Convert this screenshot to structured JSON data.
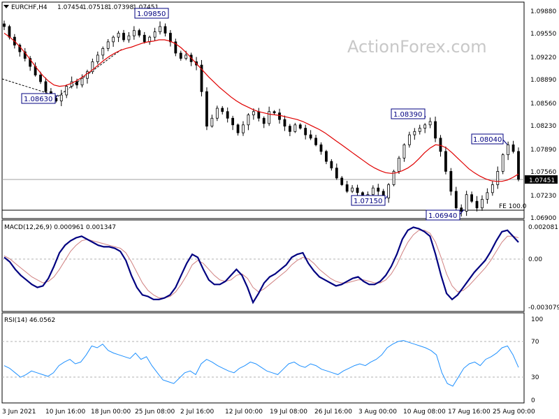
{
  "chart_data": [
    {
      "type": "candlestick",
      "panel": "price",
      "header": {
        "symbol": "EURCHF,H4",
        "ohlc": [
          "1.07454",
          "1.07518",
          "1.07398",
          "1.07451"
        ]
      },
      "watermark": "ActionForex.com",
      "ylim": [
        1.069,
        1.0999
      ],
      "yticks": [
        "1.09880",
        "1.09550",
        "1.09220",
        "1.08890",
        "1.08560",
        "1.08230",
        "1.07890",
        "1.07560",
        "1.07230",
        "1.06900"
      ],
      "current_price_label": "1.07451",
      "fe_label": "FE 100.0",
      "fe_level": 1.0698,
      "annotations": [
        "1.09850",
        "1.08630",
        "1.08390",
        "1.07150",
        "1.06940",
        "1.08040"
      ],
      "close_series": [
        1.0978,
        1.0962,
        1.095,
        1.094,
        1.093,
        1.0918,
        1.0905,
        1.0895,
        1.088,
        1.087,
        1.0866,
        1.0875,
        1.0888,
        1.0895,
        1.089,
        1.09,
        1.091,
        1.0925,
        1.0935,
        1.0945,
        1.0955,
        1.0962,
        1.0968,
        1.0958,
        1.0964,
        1.0972,
        1.0965,
        1.0955,
        1.0962,
        1.097,
        1.0978,
        1.0968,
        1.0955,
        1.0938,
        1.093,
        1.0935,
        1.0925,
        1.092,
        1.088,
        1.0828,
        1.084,
        1.0855,
        1.085,
        1.084,
        1.083,
        1.0818,
        1.083,
        1.0845,
        1.085,
        1.084,
        1.0832,
        1.085,
        1.0848,
        1.0838,
        1.0828,
        1.082,
        1.083,
        1.0825,
        1.0815,
        1.081,
        1.08,
        1.079,
        1.0775,
        1.0765,
        1.075,
        1.074,
        1.073,
        1.0735,
        1.0728,
        1.072,
        1.0725,
        1.0735,
        1.073,
        1.072,
        1.074,
        1.076,
        1.078,
        1.08,
        1.0815,
        1.082,
        1.0825,
        1.083,
        1.0835,
        1.081,
        1.079,
        1.076,
        1.073,
        1.0705,
        1.07,
        1.0725,
        1.0715,
        1.0705,
        1.0718,
        1.0728,
        1.074,
        1.076,
        1.0785,
        1.08,
        1.079,
        1.0748
      ],
      "ma_series": [
        1.0968,
        1.0962,
        1.0955,
        1.0946,
        1.0936,
        1.0925,
        1.0914,
        1.0904,
        1.0896,
        1.089,
        1.0888,
        1.0889,
        1.0892,
        1.0896,
        1.0901,
        1.0907,
        1.0913,
        1.092,
        1.0927,
        1.0933,
        1.0938,
        1.0942,
        1.0945,
        1.0947,
        1.095,
        1.0953,
        1.0955,
        1.0956,
        1.0958,
        1.0958,
        1.0956,
        1.0952,
        1.0946,
        1.0938,
        1.0929,
        1.092,
        1.0911,
        1.0902,
        1.0894,
        1.0886,
        1.0879,
        1.0872,
        1.0866,
        1.0861,
        1.0857,
        1.0853,
        1.085,
        1.0848,
        1.0846,
        1.0845,
        1.0844,
        1.0842,
        1.084,
        1.0838,
        1.0835,
        1.0831,
        1.0827,
        1.0823,
        1.0818,
        1.0812,
        1.0806,
        1.08,
        1.0794,
        1.0788,
        1.0782,
        1.0776,
        1.077,
        1.0765,
        1.0761,
        1.0758,
        1.0757,
        1.0758,
        1.0761,
        1.0765,
        1.0771,
        1.0779,
        1.0788,
        1.0795,
        1.08,
        1.0799,
        1.0795,
        1.0788,
        1.078,
        1.0772,
        1.0764,
        1.0758,
        1.0753,
        1.0749,
        1.0746,
        1.0745,
        1.0745,
        1.0747,
        1.0751,
        1.0756
      ]
    },
    {
      "type": "line",
      "panel": "macd",
      "header": "MACD(12,26,9) 0.000961 0.001347",
      "yticks": [
        "0.002081",
        "0.00",
        "-0.003079"
      ],
      "ylim": [
        -0.00332,
        0.00225
      ],
      "series": [
        {
          "values": [
            0.0,
            -0.0003,
            -0.0008,
            -0.0012,
            -0.0015,
            -0.0018,
            -0.002,
            -0.0019,
            -0.0014,
            -0.0006,
            0.0003,
            0.0008,
            0.0011,
            0.0013,
            0.0014,
            0.0012,
            0.001,
            0.0008,
            0.0007,
            0.0007,
            0.0006,
            0.0004,
            -0.0002,
            -0.0012,
            -0.002,
            -0.0025,
            -0.0026,
            -0.0028,
            -0.0028,
            -0.0027,
            -0.0025,
            -0.002,
            -0.0012,
            -0.0004,
            0.0002,
            0.0,
            -0.0008,
            -0.0015,
            -0.0018,
            -0.0018,
            -0.0016,
            -0.0012,
            -0.0008,
            -0.0012,
            -0.002,
            -0.003,
            -0.0024,
            -0.0017,
            -0.0013,
            -0.0011,
            -0.0008,
            -0.0005,
            0.0,
            0.0002,
            0.0003,
            -0.0004,
            -0.0009,
            -0.0013,
            -0.0015,
            -0.0017,
            -0.0019,
            -0.0018,
            -0.0016,
            -0.0014,
            -0.0013,
            -0.0016,
            -0.0018,
            -0.0018,
            -0.0016,
            -0.0012,
            -0.0006,
            0.0002,
            0.0012,
            0.0018,
            0.002,
            0.0019,
            0.0017,
            0.0014,
            0.0002,
            -0.0012,
            -0.0024,
            -0.0028,
            -0.0025,
            -0.002,
            -0.0015,
            -0.001,
            -0.0006,
            -0.0002,
            0.0004,
            0.0011,
            0.0017,
            0.0018,
            0.0014,
            0.001
          ]
        },
        {
          "values": [
            0.0001,
            -0.0001,
            -0.0004,
            -0.0007,
            -0.001,
            -0.0013,
            -0.0015,
            -0.0017,
            -0.0016,
            -0.0013,
            -0.0008,
            -0.0002,
            0.0004,
            0.0008,
            0.0011,
            0.0012,
            0.0011,
            0.001,
            0.0009,
            0.0008,
            0.0007,
            0.0006,
            0.0003,
            -0.0003,
            -0.001,
            -0.0017,
            -0.0022,
            -0.0025,
            -0.0027,
            -0.0027,
            -0.0026,
            -0.0023,
            -0.0018,
            -0.0012,
            -0.0005,
            -0.0002,
            -0.0004,
            -0.0008,
            -0.0012,
            -0.0015,
            -0.0016,
            -0.0015,
            -0.0012,
            -0.0011,
            -0.0014,
            -0.002,
            -0.0023,
            -0.0021,
            -0.0018,
            -0.0015,
            -0.0012,
            -0.0009,
            -0.0005,
            -0.0002,
            0.0,
            -0.0001,
            -0.0004,
            -0.0008,
            -0.0011,
            -0.0014,
            -0.0016,
            -0.0017,
            -0.0017,
            -0.0016,
            -0.0015,
            -0.0015,
            -0.0016,
            -0.0017,
            -0.0017,
            -0.0015,
            -0.0011,
            -0.0005,
            0.0003,
            0.001,
            0.0015,
            0.0018,
            0.0018,
            0.0016,
            0.001,
            0.0,
            -0.0011,
            -0.0019,
            -0.0023,
            -0.0022,
            -0.0019,
            -0.0015,
            -0.0011,
            -0.0007,
            -0.0002,
            0.0004,
            0.001,
            0.0014,
            0.0014,
            0.0013
          ]
        }
      ]
    },
    {
      "type": "line",
      "panel": "rsi",
      "header": "RSI(14) 46.0562",
      "yticks": [
        "100",
        "70",
        "30",
        "0"
      ],
      "ylim": [
        0,
        100
      ],
      "levels": [
        70,
        30
      ],
      "series": [
        {
          "values": [
            48,
            45,
            40,
            35,
            38,
            42,
            40,
            38,
            36,
            40,
            48,
            52,
            55,
            50,
            52,
            60,
            70,
            68,
            72,
            65,
            62,
            60,
            58,
            56,
            62,
            55,
            58,
            48,
            40,
            32,
            30,
            28,
            34,
            40,
            42,
            38,
            50,
            55,
            52,
            48,
            45,
            42,
            40,
            45,
            48,
            52,
            50,
            46,
            42,
            40,
            38,
            44,
            50,
            52,
            48,
            46,
            50,
            48,
            44,
            42,
            40,
            38,
            42,
            45,
            48,
            50,
            48,
            52,
            55,
            60,
            68,
            72,
            75,
            76,
            74,
            72,
            70,
            68,
            65,
            60,
            40,
            28,
            25,
            35,
            45,
            50,
            52,
            48,
            55,
            58,
            62,
            68,
            70,
            60,
            46
          ]
        }
      ]
    }
  ],
  "x_axis": {
    "labels": [
      "3 Jun 2021",
      "10 Jun 16:00",
      "18 Jun 00:00",
      "25 Jun 08:00",
      "2 Jul 16:00",
      "12 Jul 00:00",
      "19 Jul 08:00",
      "26 Jul 16:00",
      "3 Aug 00:00",
      "10 Aug 08:00",
      "17 Aug 16:00",
      "25 Aug 00:00"
    ]
  },
  "colors": {
    "candle": "#000000",
    "ma": "#e00000",
    "macd": "#000080",
    "signal": "#d08080",
    "rsi": "#1e90ff",
    "annotation": "#000080"
  }
}
